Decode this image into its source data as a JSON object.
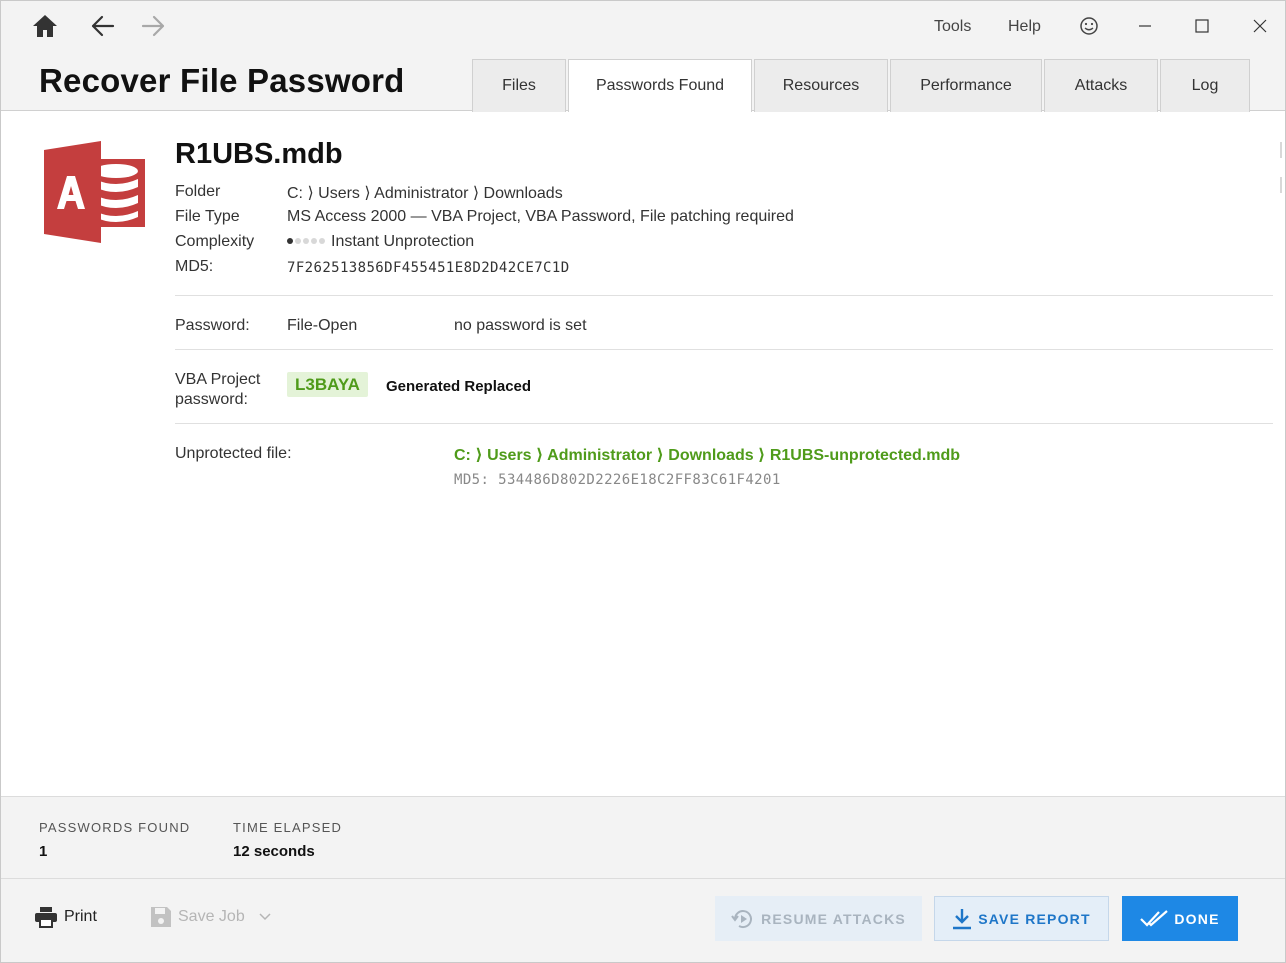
{
  "window": {
    "app_title": "Recover File Password",
    "menu": {
      "tools": "Tools",
      "help": "Help"
    }
  },
  "tabs": [
    {
      "label": "Files"
    },
    {
      "label": "Passwords Found",
      "active": true
    },
    {
      "label": "Resources"
    },
    {
      "label": "Performance"
    },
    {
      "label": "Attacks"
    },
    {
      "label": "Log"
    }
  ],
  "file": {
    "name": "R1UBS.mdb",
    "icon": "ms-access-icon",
    "folder_label": "Folder",
    "folder_value": "C: ⟩ Users ⟩ Administrator ⟩ Downloads",
    "filetype_label": "File Type",
    "filetype_value": "MS Access 2000 — VBA Project, VBA Password, File patching required",
    "complexity_label": "Complexity",
    "complexity_value": "Instant Unprotection",
    "complexity_level": 1,
    "complexity_max": 5,
    "md5_label": "MD5:",
    "md5_value": "7F262513856DF455451E8D2D42CE7C1D"
  },
  "password_row": {
    "label": "Password:",
    "type": "File-Open",
    "status": "no password is set"
  },
  "vba_row": {
    "label_line1": "VBA Project",
    "label_line2": "password:",
    "password": "L3BAYA",
    "status": "Generated Replaced"
  },
  "unprotected_row": {
    "label": "Unprotected file:",
    "path": "C: ⟩ Users ⟩ Administrator ⟩ Downloads ⟩ R1UBS-unprotected.mdb",
    "md5": "MD5: 534486D802D2226E18C2FF83C61F4201"
  },
  "stats": {
    "passwords_found_label": "PASSWORDS FOUND",
    "passwords_found_value": "1",
    "time_elapsed_label": "TIME ELAPSED",
    "time_elapsed_value": "12 seconds"
  },
  "bottom": {
    "print_label": "Print",
    "save_job_label": "Save Job",
    "resume_label": "RESUME ATTACKS",
    "save_report_label": "SAVE REPORT",
    "done_label": "DONE"
  },
  "colors": {
    "accent_green": "#4f9b1a",
    "accent_blue": "#1e88e5",
    "access_red": "#c43e3e"
  }
}
